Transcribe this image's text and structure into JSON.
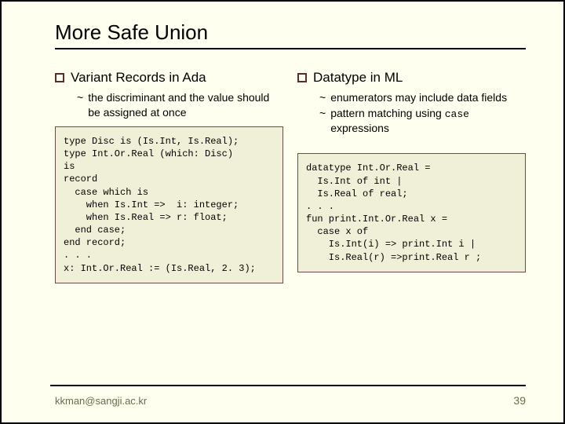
{
  "title": "More Safe Union",
  "left": {
    "heading": "Variant Records in Ada",
    "subs": [
      "the discriminant and the value should be assigned at once"
    ],
    "code": "type Disc is (Is.Int, Is.Real);\ntype Int.Or.Real (which: Disc)\nis\nrecord\n  case which is\n    when Is.Int =>  i: integer;\n    when Is.Real => r: float;\n  end case;\nend record;\n. . .\nx: Int.Or.Real := (Is.Real, 2. 3);"
  },
  "right": {
    "heading": "Datatype in ML",
    "subs": [
      "enumerators may include data fields",
      "pattern matching using case expressions"
    ],
    "code": "datatype Int.Or.Real =\n  Is.Int of int |\n  Is.Real of real;\n. . .\nfun print.Int.Or.Real x =\n  case x of\n    Is.Int(i) => print.Int i |\n    Is.Real(r) =>print.Real r ;"
  },
  "footer": {
    "email": "kkman@sangji.ac.kr",
    "page": "39"
  },
  "tilde": "~"
}
